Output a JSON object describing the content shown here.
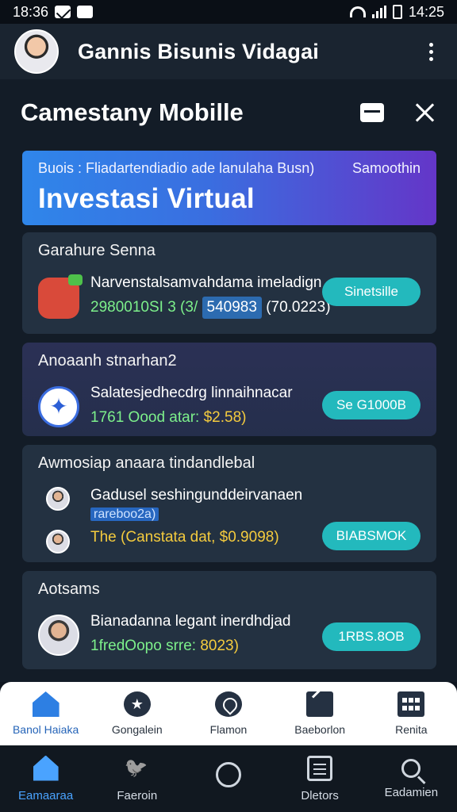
{
  "status_bar": {
    "time": "18:36",
    "clock": "14:25"
  },
  "header": {
    "title": "Gannis Bisunis Vidagai"
  },
  "panel": {
    "title": "Camestany Mobille"
  },
  "banner": {
    "subtitle": "Buois : Fliadartendiadio ade lanulaha Busn)",
    "right_text": "Samoothin",
    "title": "Investasi Virtual"
  },
  "cards": [
    {
      "heading": "Garahure Senna",
      "line1": "Narvenstalsamvahdama imeladign",
      "line2_prefix": "2980010SI 3 (3/",
      "line2_chip": "540983",
      "line2_suffix": "(70.0223)",
      "button": "Sinetsille"
    },
    {
      "heading": "Anoaanh stnarhan2",
      "line1": "Salatesjedhecdrg linnaihnacar",
      "line2_prefix": "1761 Oood atar:",
      "line2_amount": "$2.58)",
      "button": "Se G1000B"
    },
    {
      "heading": "Awmosiap anaara tindandlebal",
      "line1": "Gadusel seshingunddeirvanaen",
      "chip": "rareboo2a)",
      "line2": "The (Canstata dat, $0.9098)",
      "button": "BIABSMOK"
    },
    {
      "heading": "Aotsams",
      "line1": "Bianadanna legant inerdhdjad",
      "line2_prefix": "1fredOopo srre:",
      "line2_amount": "8023)",
      "button": "1RBS.8OB"
    }
  ],
  "action_bar": [
    {
      "label": "Banol Haiaka",
      "icon": "home-icon",
      "active": true
    },
    {
      "label": "Gongalein",
      "icon": "badge-icon"
    },
    {
      "label": "Flamon",
      "icon": "location-pin-icon"
    },
    {
      "label": "Baeborlon",
      "icon": "document-icon"
    },
    {
      "label": "Renita",
      "icon": "calculator-icon"
    }
  ],
  "bottom_nav": [
    {
      "label": "Eamaaraa",
      "icon": "home-icon",
      "active": true
    },
    {
      "label": "Faeroin",
      "icon": "bird-icon"
    },
    {
      "label": "",
      "icon": "circle-icon"
    },
    {
      "label": "Dletors",
      "icon": "list-icon"
    },
    {
      "label": "Eadamien",
      "icon": "search-icon"
    }
  ],
  "colors": {
    "accent_teal": "#23b9bd",
    "banner_start": "#2f86ea",
    "banner_end": "#6436c8",
    "amount_green": "#7df08b",
    "amount_yellow": "#f4cb3e"
  }
}
